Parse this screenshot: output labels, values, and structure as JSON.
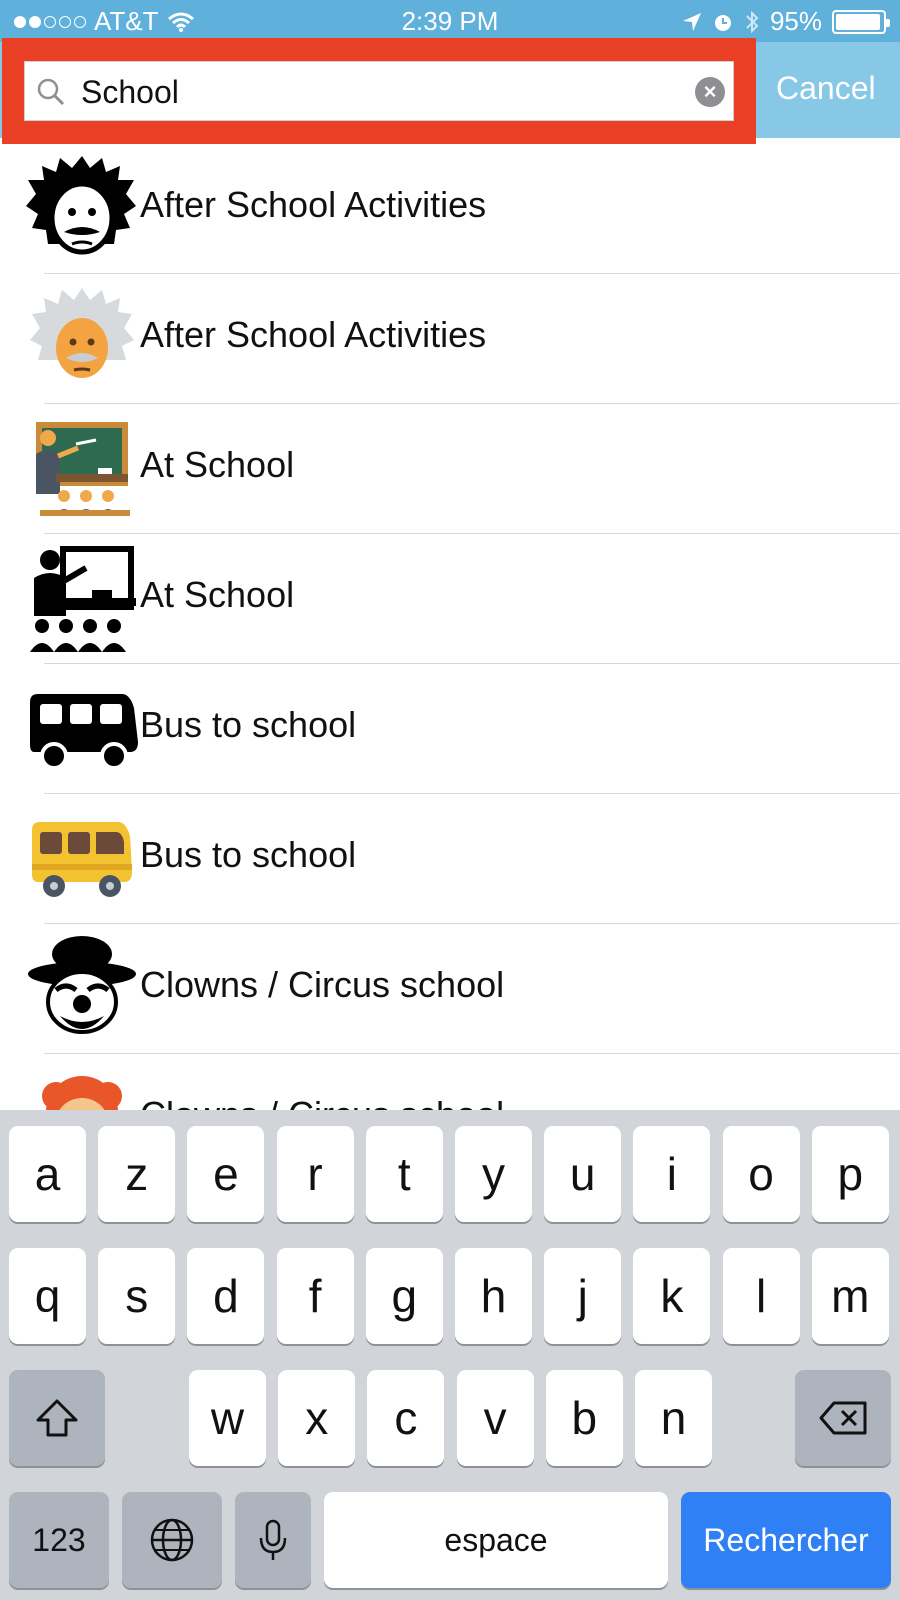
{
  "status_bar": {
    "carrier": "AT&T",
    "time": "2:39 PM",
    "battery": "95%"
  },
  "search": {
    "query": "School",
    "cancel_label": "Cancel"
  },
  "results": [
    {
      "label": "After School Activities",
      "icon": "einstein-icon"
    },
    {
      "label": "After School Activities",
      "icon": "einstein-color-icon"
    },
    {
      "label": "At School",
      "icon": "classroom-color-icon"
    },
    {
      "label": "At School",
      "icon": "classroom-icon"
    },
    {
      "label": "Bus to school",
      "icon": "bus-icon"
    },
    {
      "label": "Bus to school",
      "icon": "bus-color-icon"
    },
    {
      "label": "Clowns / Circus school",
      "icon": "clown-icon"
    },
    {
      "label": "Clowns / Circus school",
      "icon": "clown-color-icon"
    }
  ],
  "keyboard": {
    "row1": [
      "a",
      "z",
      "e",
      "r",
      "t",
      "y",
      "u",
      "i",
      "o",
      "p"
    ],
    "row2": [
      "q",
      "s",
      "d",
      "f",
      "g",
      "h",
      "j",
      "k",
      "l",
      "m"
    ],
    "row3": [
      "w",
      "x",
      "c",
      "v",
      "b",
      "n"
    ],
    "numbers_label": "123",
    "space_label": "espace",
    "search_label": "Rechercher"
  },
  "colors": {
    "accent": "#5fb1dc",
    "highlight": "#e83f25",
    "action": "#2f7ff5"
  }
}
